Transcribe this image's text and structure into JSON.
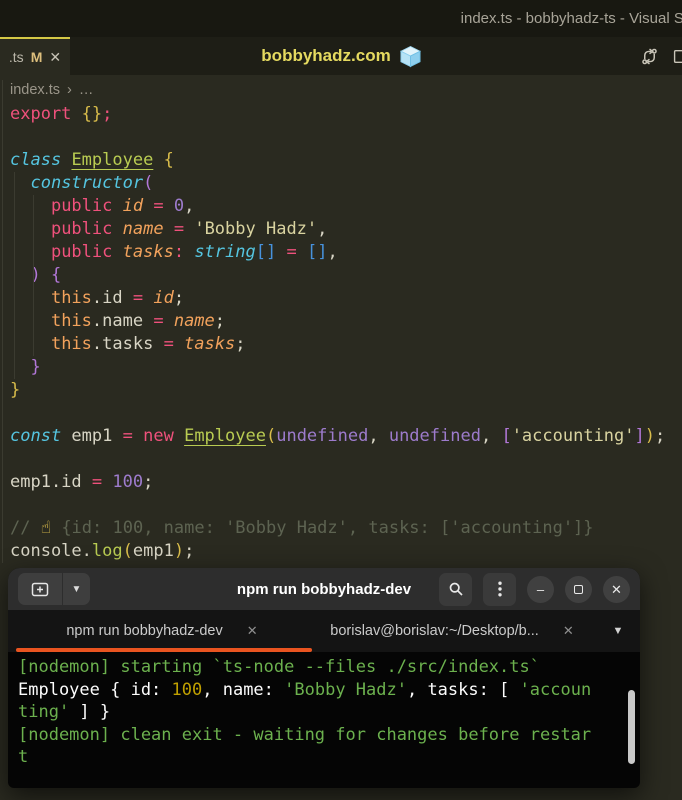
{
  "window_title": "index.ts - bobbyhadz-ts - Visual St",
  "editor": {
    "tab": {
      "label": ".ts",
      "modified": "M",
      "close": "✕"
    },
    "center_title": "bobbyhadz.com",
    "breadcrumb": {
      "file": "index.ts",
      "separator": "›",
      "more": "…"
    },
    "code_lines": [
      [
        {
          "t": "export",
          "c": "kw"
        },
        {
          "t": " "
        },
        {
          "t": "{}",
          "c": "b1"
        },
        {
          "t": ";",
          "c": "kw"
        }
      ],
      [],
      [
        {
          "t": "class",
          "c": "st"
        },
        {
          "t": " "
        },
        {
          "t": "Employee",
          "c": "cls"
        },
        {
          "t": " "
        },
        {
          "t": "{",
          "c": "b1"
        }
      ],
      [
        {
          "t": "  "
        },
        {
          "t": "constructor",
          "c": "st"
        },
        {
          "t": "(",
          "c": "b2"
        }
      ],
      [
        {
          "t": "    "
        },
        {
          "t": "public",
          "c": "kw"
        },
        {
          "t": " "
        },
        {
          "t": "id",
          "c": "var"
        },
        {
          "t": " "
        },
        {
          "t": "=",
          "c": "op"
        },
        {
          "t": " "
        },
        {
          "t": "0",
          "c": "num"
        },
        {
          "t": ","
        }
      ],
      [
        {
          "t": "    "
        },
        {
          "t": "public",
          "c": "kw"
        },
        {
          "t": " "
        },
        {
          "t": "name",
          "c": "var"
        },
        {
          "t": " "
        },
        {
          "t": "=",
          "c": "op"
        },
        {
          "t": " "
        },
        {
          "t": "'Bobby Hadz'",
          "c": "str"
        },
        {
          "t": ","
        }
      ],
      [
        {
          "t": "    "
        },
        {
          "t": "public",
          "c": "kw"
        },
        {
          "t": " "
        },
        {
          "t": "tasks",
          "c": "var"
        },
        {
          "t": ":",
          "c": "op"
        },
        {
          "t": " "
        },
        {
          "t": "string",
          "c": "st"
        },
        {
          "t": "[]",
          "c": "b3"
        },
        {
          "t": " "
        },
        {
          "t": "=",
          "c": "op"
        },
        {
          "t": " "
        },
        {
          "t": "[]",
          "c": "b3"
        },
        {
          "t": ","
        }
      ],
      [
        {
          "t": "  "
        },
        {
          "t": ") {",
          "c": "b2"
        }
      ],
      [
        {
          "t": "    "
        },
        {
          "t": "this",
          "c": "this"
        },
        {
          "t": ".id "
        },
        {
          "t": "=",
          "c": "op"
        },
        {
          "t": " "
        },
        {
          "t": "id",
          "c": "var"
        },
        {
          "t": ";"
        }
      ],
      [
        {
          "t": "    "
        },
        {
          "t": "this",
          "c": "this"
        },
        {
          "t": ".name "
        },
        {
          "t": "=",
          "c": "op"
        },
        {
          "t": " "
        },
        {
          "t": "name",
          "c": "var"
        },
        {
          "t": ";"
        }
      ],
      [
        {
          "t": "    "
        },
        {
          "t": "this",
          "c": "this"
        },
        {
          "t": ".tasks "
        },
        {
          "t": "=",
          "c": "op"
        },
        {
          "t": " "
        },
        {
          "t": "tasks",
          "c": "var"
        },
        {
          "t": ";"
        }
      ],
      [
        {
          "t": "  "
        },
        {
          "t": "}",
          "c": "b2"
        }
      ],
      [
        {
          "t": "}",
          "c": "b1"
        }
      ],
      [],
      [
        {
          "t": "const",
          "c": "st"
        },
        {
          "t": " emp1 "
        },
        {
          "t": "=",
          "c": "op"
        },
        {
          "t": " "
        },
        {
          "t": "new",
          "c": "kw"
        },
        {
          "t": " "
        },
        {
          "t": "Employee",
          "c": "cls"
        },
        {
          "t": "(",
          "c": "b1"
        },
        {
          "t": "undefined",
          "c": "num"
        },
        {
          "t": ", "
        },
        {
          "t": "undefined",
          "c": "num"
        },
        {
          "t": ", "
        },
        {
          "t": "[",
          "c": "b2"
        },
        {
          "t": "'accounting'",
          "c": "str"
        },
        {
          "t": "]",
          "c": "b2"
        },
        {
          "t": ")",
          "c": "b1"
        },
        {
          "t": ";"
        }
      ],
      [],
      [
        {
          "t": "emp1.id "
        },
        {
          "t": "=",
          "c": "op"
        },
        {
          "t": " "
        },
        {
          "t": "100",
          "c": "num"
        },
        {
          "t": ";"
        }
      ],
      [],
      [
        {
          "t": "// ",
          "c": "cmt"
        },
        {
          "t": "☝",
          "c": "emoji"
        },
        {
          "t": " {id: 100, name: 'Bobby Hadz', tasks: ['accounting']}",
          "c": "cmt"
        }
      ],
      [
        {
          "t": "console."
        },
        {
          "t": "log",
          "c": "fn"
        },
        {
          "t": "(",
          "c": "b1"
        },
        {
          "t": "emp1"
        },
        {
          "t": ")",
          "c": "b1"
        },
        {
          "t": ";"
        }
      ]
    ]
  },
  "terminal": {
    "title": "npm run bobbyhadz-dev",
    "window_buttons": {
      "minimize": "–",
      "close": "✕"
    },
    "tabs": [
      {
        "label": "npm run bobbyhadz-dev",
        "close": "✕",
        "active": true
      },
      {
        "label": "borislav@borislav:~/Desktop/b...",
        "close": "✕",
        "active": false
      }
    ],
    "tabs_dropdown": "▼",
    "newtab_dropdown": "▼",
    "output_lines": [
      [
        {
          "t": "[nodemon] starting `ts-node --files ./src/index.ts`",
          "c": "green"
        }
      ],
      [
        {
          "t": "Employee { id: ",
          "c": "white"
        },
        {
          "t": "100",
          "c": "yellow"
        },
        {
          "t": ", name: ",
          "c": "white"
        },
        {
          "t": "'Bobby Hadz'",
          "c": "green"
        },
        {
          "t": ", tasks: [ ",
          "c": "white"
        },
        {
          "t": "'accoun",
          "c": "green"
        }
      ],
      [
        {
          "t": "ting'",
          "c": "green"
        },
        {
          "t": " ] }",
          "c": "white"
        }
      ],
      [
        {
          "t": "[nodemon] clean exit - waiting for changes before restar",
          "c": "green"
        }
      ],
      [
        {
          "t": "t",
          "c": "green"
        }
      ]
    ]
  },
  "icons": {
    "ice_cube": "ice-cube-emoji",
    "pointer": "backhand-index-up-emoji",
    "open_changes": "open-changes-icon",
    "split_editor": "split-editor-icon",
    "new_tab": "new-tab-icon",
    "search": "search-icon",
    "menu": "kebab-menu-icon"
  },
  "colors": {
    "editor_bg": "#2a2a20",
    "tab_accent": "#d5c846",
    "keyword": "#ef517c",
    "storage": "#55c5e0",
    "class_name": "#b9cc52",
    "number": "#9d7bcc",
    "variable": "#f2a25c",
    "string": "#d9d3a0",
    "comment": "#5d6351",
    "bracket_gold": "#d9bd4b",
    "bracket_purple": "#b277d8",
    "bracket_blue": "#4792dc",
    "header_title": "#e5da60",
    "terminal_green": "#6cb14e",
    "terminal_yellow": "#c0a000",
    "terminal_tab_underline": "#e95420"
  }
}
